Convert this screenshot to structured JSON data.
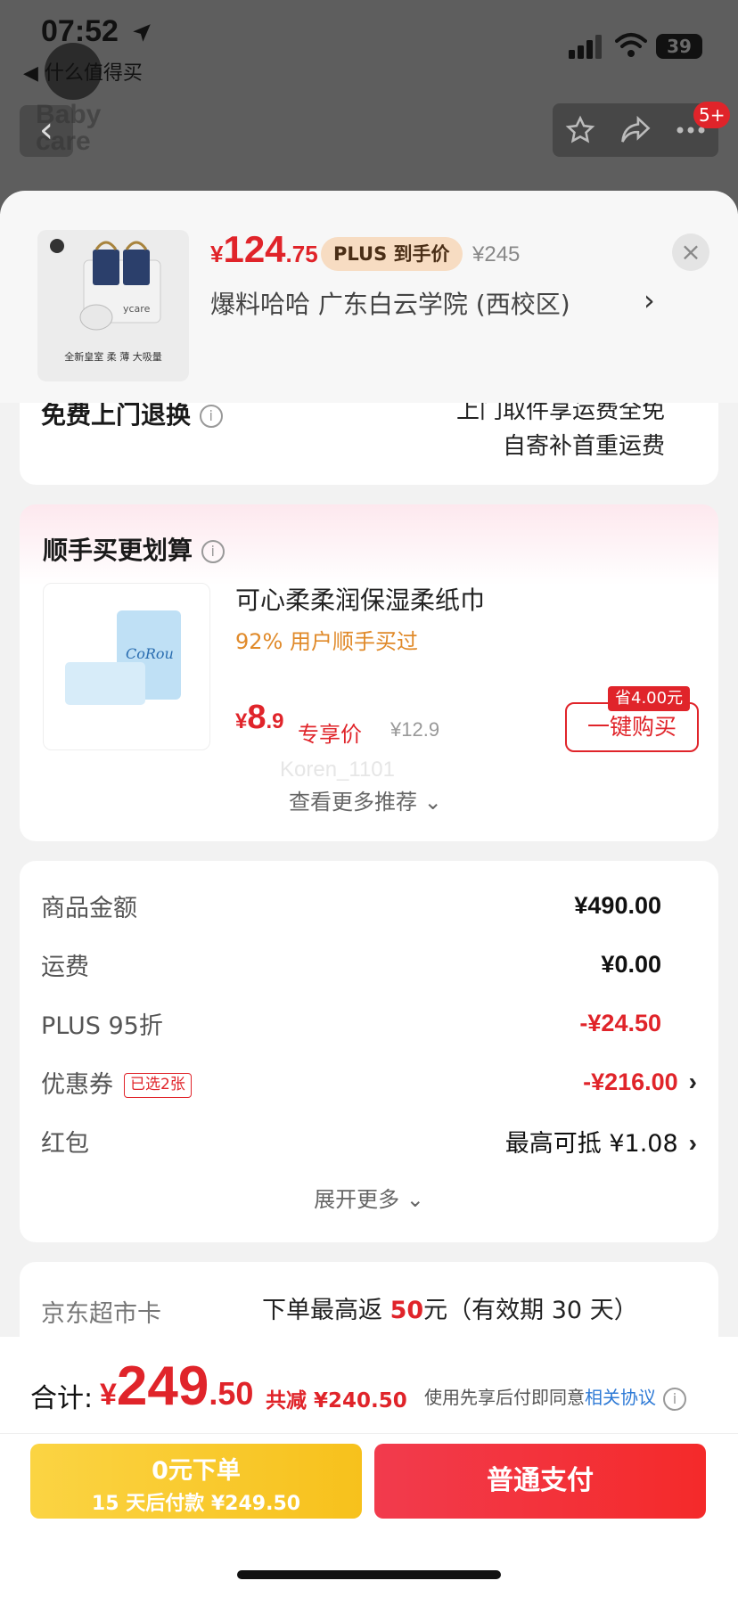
{
  "status_bar": {
    "time": "07:52",
    "back_app": "◀ 什么值得买",
    "battery": "39"
  },
  "nav": {
    "brand": "Baby\ncare",
    "badge": "5+"
  },
  "summary": {
    "price_yen": "¥",
    "price_int": "124",
    "price_dec": ".75",
    "plus_tag": "PLUS 到手价",
    "orig_price": "¥245",
    "address": "爆料哈哈  广东白云学院 (西校区)",
    "thumb_caption": "全新皇室 柔 薄 大吸量"
  },
  "returns": {
    "title": "免费上门退换",
    "line1": "上门取件享运费全免",
    "line2": "自寄补首重运费"
  },
  "recommend": {
    "title": "顺手买更划算",
    "product_name": "可心柔柔润保湿柔纸巾",
    "buy_rate": "92% 用户顺手买过",
    "price_yen": "¥",
    "price_int": "8",
    "price_dec": ".9",
    "price_tag": "专享价",
    "orig_price": "¥12.9",
    "save_badge": "省4.00元",
    "buy_button": "一键购买",
    "watermark": "Koren_1101",
    "more": "查看更多推荐"
  },
  "costs": {
    "rows": [
      {
        "label": "商品金额",
        "value": "¥490.00"
      },
      {
        "label": "运费",
        "value": "¥0.00"
      },
      {
        "label": "PLUS 95折",
        "value": "-¥24.50"
      },
      {
        "label": "优惠券",
        "value": "-¥216.00",
        "tag": "已选2张"
      },
      {
        "label": "红包",
        "value": "最高可抵 ¥1.08"
      }
    ],
    "more": "展开更多"
  },
  "jd_card": {
    "label": "京东超市卡",
    "text_before": "下单最高返 ",
    "amount": "50",
    "text_after": "元（有效期 30 天）"
  },
  "bottom": {
    "total_label": "合计:",
    "total_yen": "¥",
    "total_int": "249",
    "total_dec": ".50",
    "saved": "共减 ¥240.50",
    "agree_text": "使用先享后付即同意",
    "agree_link": "相关协议",
    "later_line1": "0元下单",
    "later_line2": "15 天后付款 ¥249.50",
    "pay_button": "普通支付"
  },
  "colors": {
    "accent_red": "#e0242a",
    "link_blue": "#2e7ad6",
    "later_yellow": "#f7c11c",
    "plus_tag_bg": "#f7dcc2"
  },
  "icons": [
    "location-arrow-icon",
    "signal-icon",
    "wifi-icon",
    "battery-icon",
    "back-icon",
    "star-icon",
    "share-icon",
    "more-icon",
    "close-icon",
    "chevron-right-icon",
    "info-icon",
    "chevron-down-icon"
  ]
}
